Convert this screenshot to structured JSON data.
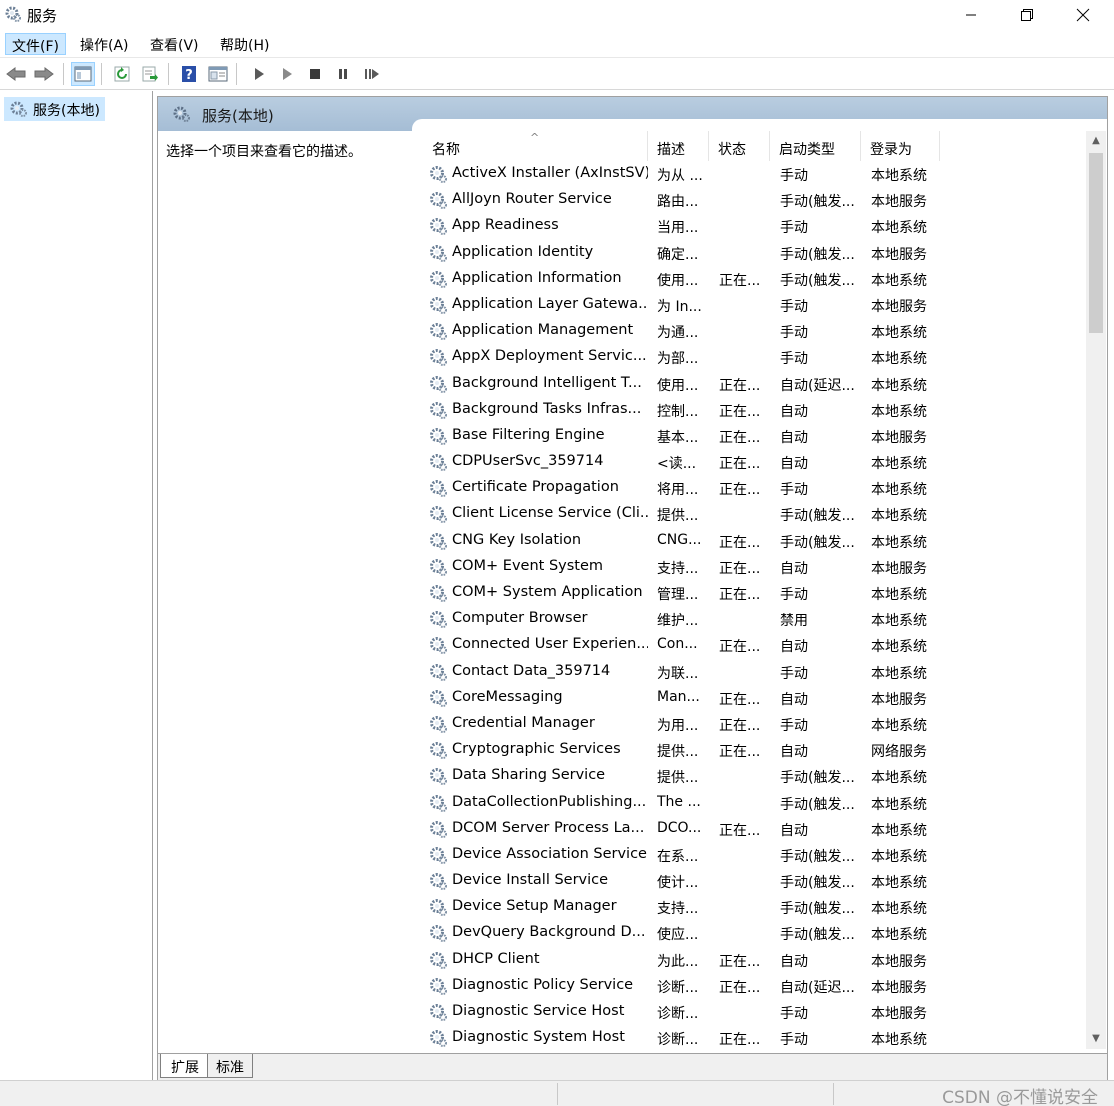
{
  "window": {
    "title": "服务"
  },
  "menu": [
    "文件(F)",
    "操作(A)",
    "查看(V)",
    "帮助(H)"
  ],
  "tree": {
    "item_label": "服务(本地)"
  },
  "panel": {
    "banner_label": "服务(本地)",
    "description": "选择一个项目来查看它的描述。"
  },
  "table": {
    "headers": [
      "名称",
      "描述",
      "状态",
      "启动类型",
      "登录为"
    ],
    "rows": [
      [
        "ActiveX Installer (AxInstSV)",
        "为从 ...",
        "",
        "手动",
        "本地系统"
      ],
      [
        "AllJoyn Router Service",
        "路由...",
        "",
        "手动(触发...",
        "本地服务"
      ],
      [
        "App Readiness",
        "当用...",
        "",
        "手动",
        "本地系统"
      ],
      [
        "Application Identity",
        "确定...",
        "",
        "手动(触发...",
        "本地服务"
      ],
      [
        "Application Information",
        "使用...",
        "正在...",
        "手动(触发...",
        "本地系统"
      ],
      [
        "Application Layer Gatewa...",
        "为 In...",
        "",
        "手动",
        "本地服务"
      ],
      [
        "Application Management",
        "为通...",
        "",
        "手动",
        "本地系统"
      ],
      [
        "AppX Deployment Servic...",
        "为部...",
        "",
        "手动",
        "本地系统"
      ],
      [
        "Background Intelligent T...",
        "使用...",
        "正在...",
        "自动(延迟...",
        "本地系统"
      ],
      [
        "Background Tasks Infras...",
        "控制...",
        "正在...",
        "自动",
        "本地系统"
      ],
      [
        "Base Filtering Engine",
        "基本...",
        "正在...",
        "自动",
        "本地服务"
      ],
      [
        "CDPUserSvc_359714",
        "<读...",
        "正在...",
        "自动",
        "本地系统"
      ],
      [
        "Certificate Propagation",
        "将用...",
        "正在...",
        "手动",
        "本地系统"
      ],
      [
        "Client License Service (Cli...",
        "提供...",
        "",
        "手动(触发...",
        "本地系统"
      ],
      [
        "CNG Key Isolation",
        "CNG...",
        "正在...",
        "手动(触发...",
        "本地系统"
      ],
      [
        "COM+ Event System",
        "支持...",
        "正在...",
        "自动",
        "本地服务"
      ],
      [
        "COM+ System Application",
        "管理...",
        "正在...",
        "手动",
        "本地系统"
      ],
      [
        "Computer Browser",
        "维护...",
        "",
        "禁用",
        "本地系统"
      ],
      [
        "Connected User Experien...",
        "Con...",
        "正在...",
        "自动",
        "本地系统"
      ],
      [
        "Contact Data_359714",
        "为联...",
        "",
        "手动",
        "本地系统"
      ],
      [
        "CoreMessaging",
        "Man...",
        "正在...",
        "自动",
        "本地服务"
      ],
      [
        "Credential Manager",
        "为用...",
        "正在...",
        "手动",
        "本地系统"
      ],
      [
        "Cryptographic Services",
        "提供...",
        "正在...",
        "自动",
        "网络服务"
      ],
      [
        "Data Sharing Service",
        "提供...",
        "",
        "手动(触发...",
        "本地系统"
      ],
      [
        "DataCollectionPublishing...",
        "The ...",
        "",
        "手动(触发...",
        "本地系统"
      ],
      [
        "DCOM Server Process La...",
        "DCO...",
        "正在...",
        "自动",
        "本地系统"
      ],
      [
        "Device Association Service",
        "在系...",
        "",
        "手动(触发...",
        "本地系统"
      ],
      [
        "Device Install Service",
        "使计...",
        "",
        "手动(触发...",
        "本地系统"
      ],
      [
        "Device Setup Manager",
        "支持...",
        "",
        "手动(触发...",
        "本地系统"
      ],
      [
        "DevQuery Background D...",
        "使应...",
        "",
        "手动(触发...",
        "本地系统"
      ],
      [
        "DHCP Client",
        "为此...",
        "正在...",
        "自动",
        "本地服务"
      ],
      [
        "Diagnostic Policy Service",
        "诊断...",
        "正在...",
        "自动(延迟...",
        "本地服务"
      ],
      [
        "Diagnostic Service Host",
        "诊断...",
        "",
        "手动",
        "本地服务"
      ],
      [
        "Diagnostic System Host",
        "诊断...",
        "正在...",
        "手动",
        "本地系统"
      ]
    ]
  },
  "tabs": [
    "扩展",
    "标准"
  ],
  "watermark": "CSDN @不懂说安全"
}
